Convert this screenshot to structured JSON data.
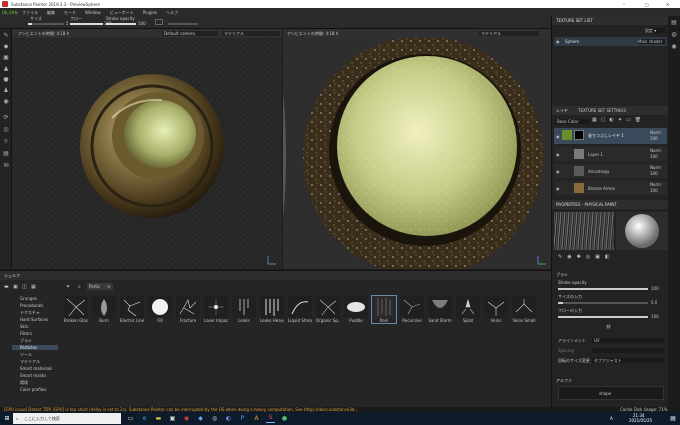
{
  "window": {
    "title": "Substance Painter 2019.3.3 - PreviewSphere",
    "min_glyph": "─",
    "max_glyph": "□",
    "close_glyph": "✕"
  },
  "menu": {
    "badge": "UIいUIを",
    "items": [
      "ファイル",
      "編集",
      "モード",
      "Window",
      "ビューポート",
      "Plugins",
      "ヘルプ"
    ]
  },
  "toolbar": {
    "size_label": "サイズ",
    "flow_label": "フロー",
    "stroke_label": "Stroke opacity",
    "size_val": "5",
    "flow_val": "100",
    "stroke_val": "100"
  },
  "viewport_left": {
    "label": "アンビエントの時間: 4:18 h",
    "camera": "Default camera",
    "material": "マテリアル"
  },
  "viewport_right": {
    "label": "アンビエントの時間: 4:18 h",
    "material": "マテリアル"
  },
  "texture_set_list": {
    "title": "TEXTURE SET LIST",
    "settings": "設定 ▾",
    "set_name": "Sphere",
    "shader": "Main shader"
  },
  "layers": {
    "tab_layers": "レイヤ",
    "tab_tss": "TEXTURE SET SETTINGS",
    "blend_mode": "Base Color",
    "items": [
      {
        "name": "塗りつぶしレイヤ 1",
        "blend": "Norm",
        "opacity": "100",
        "color": "#6a8f2a",
        "selected": true
      },
      {
        "name": "Layer 1",
        "blend": "Norm",
        "opacity": "100",
        "color": "#7a7a7a",
        "selected": false
      },
      {
        "name": "Anisotropy",
        "blend": "Norm",
        "opacity": "100",
        "color": "#5a5a5a",
        "selected": false
      },
      {
        "name": "Bronze Armor",
        "blend": "Norm",
        "opacity": "100",
        "color": "#8a6a3a",
        "selected": false
      }
    ]
  },
  "properties": {
    "title": "PROPERTIES - PHYSICAL PAINT",
    "brush_section": "ブラシ",
    "sliders": [
      {
        "label": "Stroke opacity",
        "value": "100",
        "fill": 1.0
      },
      {
        "label": "サイズの入力",
        "value": "5.0",
        "fill": 0.05
      },
      {
        "label": "フローの入力",
        "value": "100",
        "fill": 1.0
      }
    ],
    "alignment_label": "アラインメント",
    "alignment_value": "UV",
    "spacing_label": "Spacing",
    "spacing_value": "",
    "angle_label": "回転のサイズ変更",
    "angle_value": "タブアジャスト",
    "alpha_section": "アルファ",
    "alpha_value": "shape"
  },
  "shelf": {
    "title": "シェルフ",
    "filter": "Partic",
    "search_tag": "✕",
    "categories": [
      "Grunges",
      "Procedurals",
      "テクスチャ",
      "Hard Surfaces",
      "Skin",
      "Filters",
      "ブラシ",
      "Particles",
      "ツール",
      "マテリアル",
      "Smart materials",
      "Smart masks",
      "環境",
      "Color profiles"
    ],
    "selected_category": "Particles",
    "items": [
      "Broken Glass",
      "Burn",
      "Electric Lines",
      "Fill",
      "Fracture",
      "Laser Impacts",
      "Leaks",
      "Leaks Heavy",
      "Liquid Stream",
      "Organic Sp...",
      "Puddle",
      "Rain",
      "Recursive",
      "Sand Storm",
      "Splat",
      "Veins",
      "Veins Small"
    ],
    "selected_item": "Rain"
  },
  "status": {
    "message": "[GPU issue] Detect TDR [GPU] is too short (delay is set to 2s). Substance Painter can be interrupted by the OS when doing a heavy computation. See https://docs.substance3d...",
    "right": "Cache Disk Usage: 71%"
  },
  "taskbar": {
    "search_placeholder": "ここに入力して検索",
    "time": "21:34",
    "date": "2021/05/25",
    "lang": "A"
  }
}
